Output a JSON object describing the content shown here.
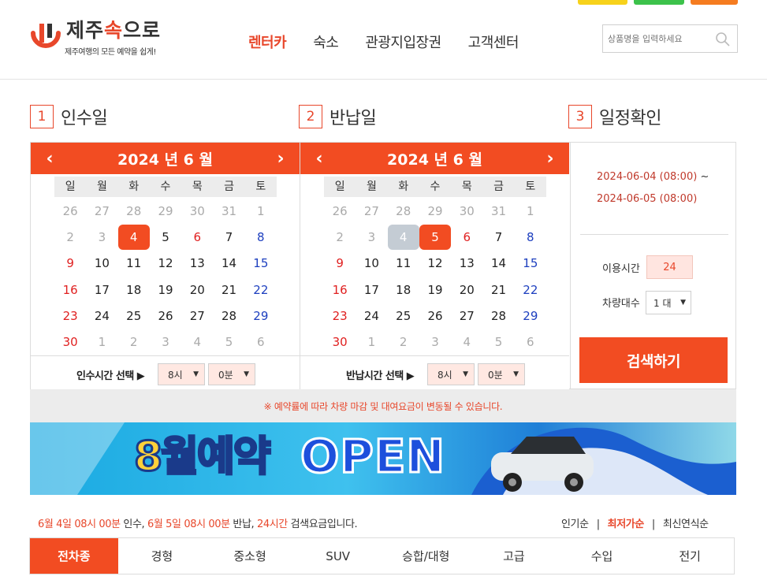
{
  "header": {
    "logo_title_a": "제주",
    "logo_title_b": "속",
    "logo_title_c": "으로",
    "logo_sub": "제주여행의 모든 예약을 쉽게!",
    "nav": [
      "렌터카",
      "숙소",
      "관광지입장권",
      "고객센터"
    ],
    "nav_active": 0,
    "search_placeholder": "상품명을 입력하세요",
    "top_pill_colors": [
      "#f7d21b",
      "#3cc24b",
      "#f57c20"
    ]
  },
  "steps": [
    {
      "num": "1",
      "label": "인수일"
    },
    {
      "num": "2",
      "label": "반납일"
    },
    {
      "num": "3",
      "label": "일정확인"
    }
  ],
  "calendars": [
    {
      "title": "2024 년 6 월",
      "weekdays": [
        "일",
        "월",
        "화",
        "수",
        "목",
        "금",
        "토"
      ],
      "weeks": [
        [
          "26",
          "27",
          "28",
          "29",
          "30",
          "31",
          "1"
        ],
        [
          "2",
          "3",
          "4",
          "5",
          "6",
          "7",
          "8"
        ],
        [
          "9",
          "10",
          "11",
          "12",
          "13",
          "14",
          "15"
        ],
        [
          "16",
          "17",
          "18",
          "19",
          "20",
          "21",
          "22"
        ],
        [
          "23",
          "24",
          "25",
          "26",
          "27",
          "28",
          "29"
        ],
        [
          "30",
          "1",
          "2",
          "3",
          "4",
          "5",
          "6"
        ]
      ],
      "time_label": "인수시간 선택 ▶",
      "hour": "8시",
      "minute": "0분"
    },
    {
      "title": "2024 년 6 월",
      "weekdays": [
        "일",
        "월",
        "화",
        "수",
        "목",
        "금",
        "토"
      ],
      "weeks": [
        [
          "26",
          "27",
          "28",
          "29",
          "30",
          "31",
          "1"
        ],
        [
          "2",
          "3",
          "4",
          "5",
          "6",
          "7",
          "8"
        ],
        [
          "9",
          "10",
          "11",
          "12",
          "13",
          "14",
          "15"
        ],
        [
          "16",
          "17",
          "18",
          "19",
          "20",
          "21",
          "22"
        ],
        [
          "23",
          "24",
          "25",
          "26",
          "27",
          "28",
          "29"
        ],
        [
          "30",
          "1",
          "2",
          "3",
          "4",
          "5",
          "6"
        ]
      ],
      "time_label": "반납시간 선택 ▶",
      "hour": "8시",
      "minute": "0분"
    }
  ],
  "confirm": {
    "start": "2024-06-04 (08:00)",
    "tilde": "~",
    "end": "2024-06-05 (08:00)",
    "hours_label": "이용시간",
    "hours_value": "24",
    "cars_label": "차량대수",
    "cars_value": "1 대",
    "search_button": "검색하기"
  },
  "notice": "※ 예약률에 따라 차량 마감 및 대여요금이 변동될 수 있습니다.",
  "banner": {
    "text_a": "8월예약",
    "text_b": "OPEN"
  },
  "summary": {
    "p1": "6월 4일 08시 00분",
    "p2": " 인수, ",
    "p3": "6월 5일 08시 00분",
    "p4": " 반납, ",
    "p5": "24시간",
    "p6": " 검색요금입니다."
  },
  "sort": {
    "items": [
      "인기순",
      "최저가순",
      "최신연식순"
    ],
    "active": 1,
    "separator": "|"
  },
  "tabs": {
    "items": [
      "전차종",
      "경형",
      "중소형",
      "SUV",
      "승합/대형",
      "고급",
      "수입",
      "전기"
    ],
    "active": 0
  },
  "arrows": {
    "prev": "‹",
    "next": "›",
    "caret": "▼"
  }
}
